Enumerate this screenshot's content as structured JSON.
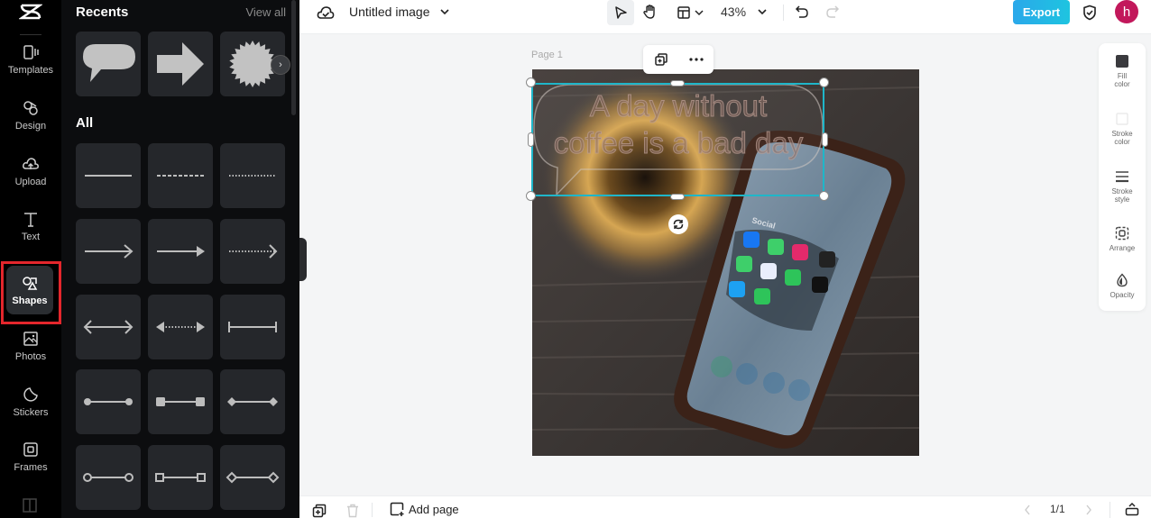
{
  "rail": {
    "logo": "capcut-logo",
    "items": [
      {
        "label": "Templates",
        "icon": "templates-icon"
      },
      {
        "label": "Design",
        "icon": "design-icon"
      },
      {
        "label": "Upload",
        "icon": "upload-cloud-icon"
      },
      {
        "label": "Text",
        "icon": "text-icon"
      },
      {
        "label": "Shapes",
        "icon": "shapes-icon",
        "active": true
      },
      {
        "label": "Photos",
        "icon": "photos-icon"
      },
      {
        "label": "Stickers",
        "icon": "stickers-icon"
      },
      {
        "label": "Frames",
        "icon": "frames-icon"
      }
    ]
  },
  "panel": {
    "recents_title": "Recents",
    "view_all": "View all",
    "all_title": "All",
    "recents": [
      "speech-bubble",
      "arrow-right-block",
      "starburst"
    ],
    "shapes": [
      "line-solid",
      "line-dashed",
      "line-dotted",
      "arrow-line",
      "arrow-filled",
      "arrow-dotted",
      "double-arrow",
      "double-arrow-dotted-filled",
      "line-end-bars",
      "line-dots",
      "line-squares",
      "line-diamonds",
      "line-circles-outline",
      "line-squares-outline",
      "line-diamonds-outline"
    ]
  },
  "topbar": {
    "doc_title": "Untitled image",
    "zoom": "43%",
    "export": "Export",
    "avatar_initial": "h",
    "accent": "#1ec4e0"
  },
  "canvas": {
    "page_label": "Page 1",
    "bubble_text_line1": "A day without",
    "bubble_text_line2": "coffee is a bad day",
    "phone_folder_label": "Social",
    "selection_color": "#1fb6c9"
  },
  "props": [
    {
      "label1": "Fill",
      "label2": "color"
    },
    {
      "label1": "Stroke",
      "label2": "color"
    },
    {
      "label1": "Stroke",
      "label2": "style"
    },
    {
      "label1": "Arrange",
      "label2": ""
    },
    {
      "label1": "Opacity",
      "label2": ""
    }
  ],
  "bottombar": {
    "add_page": "Add page",
    "page_count": "1/1"
  }
}
